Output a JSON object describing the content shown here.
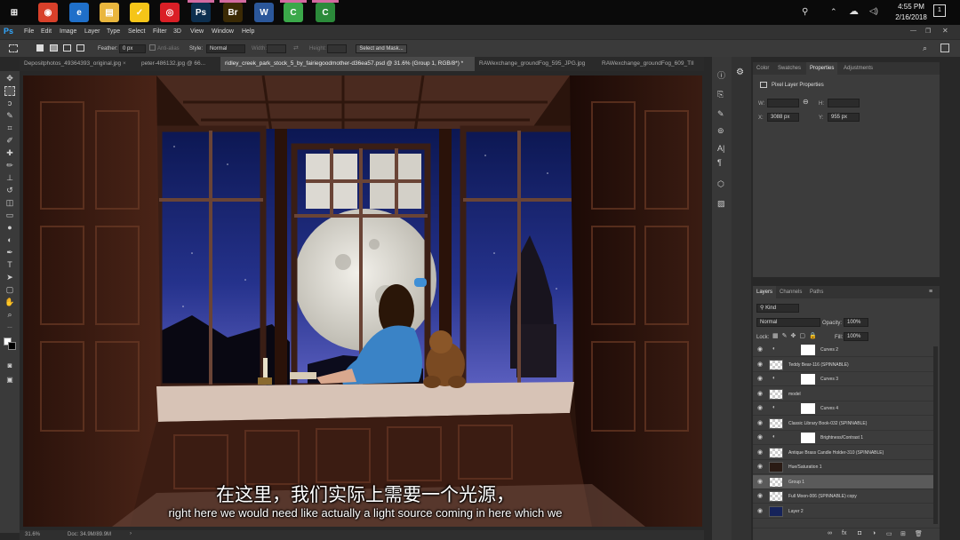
{
  "taskbar": {
    "clock_time": "4:55 PM",
    "clock_date": "2/16/2018",
    "apps": [
      {
        "name": "windows-start",
        "glyph": "⊞",
        "color": "#0a0a0a"
      },
      {
        "name": "chrome",
        "glyph": "◉",
        "color": "#d8402a"
      },
      {
        "name": "edge",
        "glyph": "e",
        "color": "#1f6fc9"
      },
      {
        "name": "file-explorer",
        "glyph": "▤",
        "color": "#e9b63d"
      },
      {
        "name": "norton",
        "glyph": "✓",
        "color": "#f5c518"
      },
      {
        "name": "creative-cloud",
        "glyph": "◎",
        "color": "#da1f26"
      },
      {
        "name": "photoshop",
        "glyph": "Ps",
        "color": "#0d2f4f"
      },
      {
        "name": "bridge",
        "glyph": "Br",
        "color": "#3b2a05"
      },
      {
        "name": "word",
        "glyph": "W",
        "color": "#2b579a"
      },
      {
        "name": "camtasia",
        "glyph": "C",
        "color": "#3ba84a"
      },
      {
        "name": "camtasia-recorder",
        "glyph": "C",
        "color": "#2b8a3a"
      }
    ]
  },
  "menubar": {
    "logo": "Ps",
    "items": [
      "File",
      "Edit",
      "Image",
      "Layer",
      "Type",
      "Select",
      "Filter",
      "3D",
      "View",
      "Window",
      "Help"
    ]
  },
  "options": {
    "feather_label": "Feather:",
    "feather_value": "0 px",
    "antialias_label": "Anti-alias",
    "style_label": "Style:",
    "style_value": "Normal",
    "width_label": "Width:",
    "height_label": "Height:",
    "select_mask": "Select and Mask..."
  },
  "tabs": [
    "Depositphotos_49364393_original.jpg",
    "peter-486132.jpg @ 66...",
    "ridley_creek_park_stock_5_by_fairiegoodmother-d36ea57.psd @ 31.6% (Group 1, RGB/8*) *",
    "RAWexchange_groundFog_595_JPG.jpg",
    "RAWexchange_groundFog_609_TII"
  ],
  "status": {
    "zoom": "31.6%",
    "doc": "Doc: 34.9M/89.9M"
  },
  "properties": {
    "tabs": [
      "Color",
      "Swatches",
      "Properties",
      "Adjustments"
    ],
    "title": "Pixel Layer Properties",
    "w_label": "W:",
    "h_label": "H:",
    "x_label": "X:",
    "x_value": "3088 px",
    "y_label": "Y:",
    "y_value": "955 px"
  },
  "layers_panel": {
    "tabs": [
      "Layers",
      "Channels",
      "Paths"
    ],
    "filter": "Kind",
    "blend": "Normal",
    "opacity_label": "Opacity:",
    "opacity": "100%",
    "lock_label": "Lock:",
    "fill_label": "Fill:",
    "fill": "100%",
    "layers": [
      {
        "name": "Curves 2",
        "kind": "adj"
      },
      {
        "name": "Teddy Bear-116 (SPINNABLE)",
        "kind": "pixel"
      },
      {
        "name": "Curves 3",
        "kind": "adj"
      },
      {
        "name": "model",
        "kind": "pixel"
      },
      {
        "name": "Curves 4",
        "kind": "adj"
      },
      {
        "name": "Classic Library Book-032 (SPINNABLE)",
        "kind": "pixel"
      },
      {
        "name": "Brightness/Contrast 1",
        "kind": "adj"
      },
      {
        "name": "Antique Brass Candle Holder-310 (SPINNABLE)",
        "kind": "pixel"
      },
      {
        "name": "Hue/Saturation 1",
        "kind": "hue"
      },
      {
        "name": "Group 1",
        "kind": "pixel"
      },
      {
        "name": "Full Moon-006 (SPINNABLE) copy",
        "kind": "pixel"
      },
      {
        "name": "Layer 2",
        "kind": "sky"
      }
    ],
    "selected_index": 9
  },
  "subtitles": {
    "chinese": "在这里，我们实际上需要一个光源，",
    "english": "right here we would need like actually a light source coming in here which we"
  }
}
